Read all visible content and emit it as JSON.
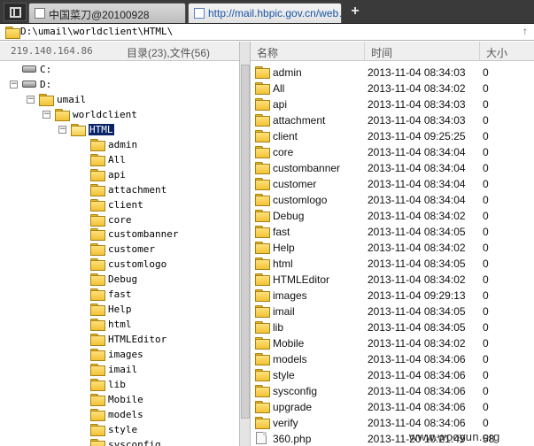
{
  "tabs": [
    {
      "label": "中国菜刀@20100928",
      "active": false
    },
    {
      "label": "http://mail.hbpic.gov.cn/web…",
      "active": true
    }
  ],
  "new_tab_label": "+",
  "path": "D:\\umail\\worldclient\\HTML\\",
  "ip": "219.140.164.86",
  "counts_label": "目录(23),文件(56)",
  "columns": {
    "name": "名称",
    "time": "时间",
    "size": "大小"
  },
  "tree": [
    {
      "label": "C:",
      "type": "drive",
      "toggle": "",
      "depth": 0
    },
    {
      "label": "D:",
      "type": "drive",
      "toggle": "−",
      "depth": 0
    },
    {
      "label": "umail",
      "type": "folder",
      "toggle": "−",
      "depth": 1
    },
    {
      "label": "worldclient",
      "type": "folder",
      "toggle": "−",
      "depth": 2
    },
    {
      "label": "HTML",
      "type": "folder-open",
      "toggle": "−",
      "depth": 3,
      "selected": true
    },
    {
      "label": "admin",
      "type": "folder",
      "depth": 4
    },
    {
      "label": "All",
      "type": "folder",
      "depth": 4
    },
    {
      "label": "api",
      "type": "folder",
      "depth": 4
    },
    {
      "label": "attachment",
      "type": "folder",
      "depth": 4
    },
    {
      "label": "client",
      "type": "folder",
      "depth": 4
    },
    {
      "label": "core",
      "type": "folder",
      "depth": 4
    },
    {
      "label": "custombanner",
      "type": "folder",
      "depth": 4
    },
    {
      "label": "customer",
      "type": "folder",
      "depth": 4
    },
    {
      "label": "customlogo",
      "type": "folder",
      "depth": 4
    },
    {
      "label": "Debug",
      "type": "folder",
      "depth": 4
    },
    {
      "label": "fast",
      "type": "folder",
      "depth": 4
    },
    {
      "label": "Help",
      "type": "folder",
      "depth": 4
    },
    {
      "label": "html",
      "type": "folder",
      "depth": 4
    },
    {
      "label": "HTMLEditor",
      "type": "folder",
      "depth": 4
    },
    {
      "label": "images",
      "type": "folder",
      "depth": 4
    },
    {
      "label": "imail",
      "type": "folder",
      "depth": 4
    },
    {
      "label": "lib",
      "type": "folder",
      "depth": 4
    },
    {
      "label": "Mobile",
      "type": "folder",
      "depth": 4
    },
    {
      "label": "models",
      "type": "folder",
      "depth": 4
    },
    {
      "label": "style",
      "type": "folder",
      "depth": 4
    },
    {
      "label": "sysconfig",
      "type": "folder",
      "depth": 4
    }
  ],
  "files": [
    {
      "name": "admin",
      "time": "2013-11-04 08:34:03",
      "size": "0",
      "type": "folder"
    },
    {
      "name": "All",
      "time": "2013-11-04 08:34:02",
      "size": "0",
      "type": "folder"
    },
    {
      "name": "api",
      "time": "2013-11-04 08:34:03",
      "size": "0",
      "type": "folder"
    },
    {
      "name": "attachment",
      "time": "2013-11-04 08:34:03",
      "size": "0",
      "type": "folder"
    },
    {
      "name": "client",
      "time": "2013-11-04 09:25:25",
      "size": "0",
      "type": "folder"
    },
    {
      "name": "core",
      "time": "2013-11-04 08:34:04",
      "size": "0",
      "type": "folder"
    },
    {
      "name": "custombanner",
      "time": "2013-11-04 08:34:04",
      "size": "0",
      "type": "folder"
    },
    {
      "name": "customer",
      "time": "2013-11-04 08:34:04",
      "size": "0",
      "type": "folder"
    },
    {
      "name": "customlogo",
      "time": "2013-11-04 08:34:04",
      "size": "0",
      "type": "folder"
    },
    {
      "name": "Debug",
      "time": "2013-11-04 08:34:02",
      "size": "0",
      "type": "folder"
    },
    {
      "name": "fast",
      "time": "2013-11-04 08:34:05",
      "size": "0",
      "type": "folder"
    },
    {
      "name": "Help",
      "time": "2013-11-04 08:34:02",
      "size": "0",
      "type": "folder"
    },
    {
      "name": "html",
      "time": "2013-11-04 08:34:05",
      "size": "0",
      "type": "folder"
    },
    {
      "name": "HTMLEditor",
      "time": "2013-11-04 08:34:02",
      "size": "0",
      "type": "folder"
    },
    {
      "name": "images",
      "time": "2013-11-04 09:29:13",
      "size": "0",
      "type": "folder"
    },
    {
      "name": "imail",
      "time": "2013-11-04 08:34:05",
      "size": "0",
      "type": "folder"
    },
    {
      "name": "lib",
      "time": "2013-11-04 08:34:05",
      "size": "0",
      "type": "folder"
    },
    {
      "name": "Mobile",
      "time": "2013-11-04 08:34:02",
      "size": "0",
      "type": "folder"
    },
    {
      "name": "models",
      "time": "2013-11-04 08:34:06",
      "size": "0",
      "type": "folder"
    },
    {
      "name": "style",
      "time": "2013-11-04 08:34:06",
      "size": "0",
      "type": "folder"
    },
    {
      "name": "sysconfig",
      "time": "2013-11-04 08:34:06",
      "size": "0",
      "type": "folder"
    },
    {
      "name": "upgrade",
      "time": "2013-11-04 08:34:06",
      "size": "0",
      "type": "folder"
    },
    {
      "name": "verify",
      "time": "2013-11-04 08:34:06",
      "size": "0",
      "type": "folder"
    },
    {
      "name": "360.php",
      "time": "2013-11-20 10:21:49",
      "size": "58",
      "type": "file"
    }
  ],
  "watermark": "www.wooyun.org"
}
